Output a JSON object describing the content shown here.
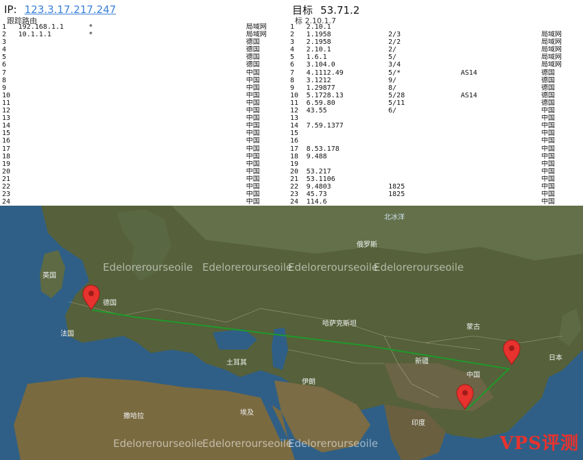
{
  "left_panel": {
    "header_label": "IP:",
    "header_ip": "123.3.17.217.247",
    "subtitle": "跟踪路由"
  },
  "right_panel": {
    "header_label": "目标",
    "header_ip": "53.71.2",
    "subtitle": "标 2.10.1.7"
  },
  "left_hops": [
    {
      "no": "1",
      "ip": "192.168.1.1",
      "loss": "*",
      "t1": "",
      "t2": "",
      "t3": "",
      "asn": "",
      "host": "",
      "loc": "局域网"
    },
    {
      "no": "2",
      "ip": "10.1.1.1",
      "loss": "*",
      "t1": "",
      "t2": "",
      "t3": "",
      "asn": "",
      "host": "",
      "loc": "局域网"
    },
    {
      "no": "3",
      "ip": "",
      "loss": "",
      "t1": "",
      "t2": "",
      "t3": "",
      "asn": "",
      "host": "",
      "loc": "德国"
    },
    {
      "no": "4",
      "ip": "",
      "loss": "",
      "t1": "",
      "t2": "",
      "t3": "",
      "asn": "",
      "host": "",
      "loc": "德国"
    },
    {
      "no": "5",
      "ip": "",
      "loss": "",
      "t1": "",
      "t2": "",
      "t3": "",
      "asn": "",
      "host": "",
      "loc": "德国"
    },
    {
      "no": "6",
      "ip": "",
      "loss": "",
      "t1": "",
      "t2": "",
      "t3": "",
      "asn": "",
      "host": "",
      "loc": "德国"
    },
    {
      "no": "7",
      "ip": "",
      "loss": "",
      "t1": "",
      "t2": "",
      "t3": "",
      "asn": "",
      "host": "",
      "loc": "中国"
    },
    {
      "no": "8",
      "ip": "",
      "loss": "",
      "t1": "",
      "t2": "",
      "t3": "",
      "asn": "",
      "host": "",
      "loc": "中国"
    },
    {
      "no": "9",
      "ip": "",
      "loss": "",
      "t1": "",
      "t2": "",
      "t3": "",
      "asn": "",
      "host": "",
      "loc": "中国"
    },
    {
      "no": "10",
      "ip": "",
      "loss": "",
      "t1": "",
      "t2": "",
      "t3": "",
      "asn": "",
      "host": "",
      "loc": "中国"
    },
    {
      "no": "11",
      "ip": "",
      "loss": "",
      "t1": "",
      "t2": "",
      "t3": "",
      "asn": "",
      "host": "",
      "loc": "中国"
    },
    {
      "no": "12",
      "ip": "",
      "loss": "",
      "t1": "",
      "t2": "",
      "t3": "",
      "asn": "",
      "host": "",
      "loc": "中国"
    },
    {
      "no": "13",
      "ip": "",
      "loss": "",
      "t1": "",
      "t2": "",
      "t3": "",
      "asn": "",
      "host": "",
      "loc": "中国"
    },
    {
      "no": "14",
      "ip": "",
      "loss": "",
      "t1": "",
      "t2": "",
      "t3": "",
      "asn": "",
      "host": "",
      "loc": "中国"
    },
    {
      "no": "15",
      "ip": "",
      "loss": "",
      "t1": "",
      "t2": "",
      "t3": "",
      "asn": "",
      "host": "",
      "loc": "中国"
    },
    {
      "no": "16",
      "ip": "",
      "loss": "",
      "t1": "",
      "t2": "",
      "t3": "",
      "asn": "",
      "host": "",
      "loc": "中国"
    },
    {
      "no": "17",
      "ip": "",
      "loss": "",
      "t1": "",
      "t2": "",
      "t3": "",
      "asn": "",
      "host": "",
      "loc": "中国"
    },
    {
      "no": "18",
      "ip": "",
      "loss": "",
      "t1": "",
      "t2": "",
      "t3": "",
      "asn": "",
      "host": "",
      "loc": "中国"
    },
    {
      "no": "19",
      "ip": "",
      "loss": "",
      "t1": "",
      "t2": "",
      "t3": "",
      "asn": "",
      "host": "",
      "loc": "中国"
    },
    {
      "no": "20",
      "ip": "",
      "loss": "",
      "t1": "",
      "t2": "",
      "t3": "",
      "asn": "",
      "host": "",
      "loc": "中国"
    },
    {
      "no": "21",
      "ip": "",
      "loss": "",
      "t1": "",
      "t2": "",
      "t3": "",
      "asn": "",
      "host": "",
      "loc": "中国"
    },
    {
      "no": "22",
      "ip": "",
      "loss": "",
      "t1": "",
      "t2": "",
      "t3": "",
      "asn": "",
      "host": "",
      "loc": "中国"
    },
    {
      "no": "23",
      "ip": "",
      "loss": "",
      "t1": "",
      "t2": "",
      "t3": "",
      "asn": "",
      "host": "",
      "loc": "中国"
    },
    {
      "no": "24",
      "ip": "",
      "loss": "",
      "t1": "",
      "t2": "",
      "t3": "",
      "asn": "",
      "host": "",
      "loc": "中国"
    }
  ],
  "right_hops": [
    {
      "no": "1",
      "ip": "2.10.1",
      "loss": "",
      "t1": "",
      "t2": "",
      "t3": "",
      "asn": "",
      "host": "",
      "loc": ""
    },
    {
      "no": "2",
      "ip": "1.1958",
      "loss": "",
      "t1": "2/3",
      "t2": "",
      "t3": "",
      "asn": "",
      "host": "",
      "loc": "局域网"
    },
    {
      "no": "3",
      "ip": "2.1958",
      "loss": "",
      "t1": "2/2",
      "t2": "",
      "t3": "",
      "asn": "",
      "host": "",
      "loc": "局域网"
    },
    {
      "no": "4",
      "ip": "2.10.1",
      "loss": "",
      "t1": "2/",
      "t2": "",
      "t3": "",
      "asn": "",
      "host": "",
      "loc": "局域网"
    },
    {
      "no": "5",
      "ip": "1.6.1",
      "loss": "",
      "t1": "5/",
      "t2": "",
      "t3": "",
      "asn": "",
      "host": "",
      "loc": "局域网"
    },
    {
      "no": "6",
      "ip": "3.104.0",
      "loss": "",
      "t1": "3/4",
      "t2": "",
      "t3": "",
      "asn": "",
      "host": "",
      "loc": "局域网"
    },
    {
      "no": "7",
      "ip": "4.1112.49",
      "loss": "",
      "t1": "5/*",
      "t2": "",
      "t3": "",
      "asn": "AS14",
      "host": "",
      "loc": "德国"
    },
    {
      "no": "8",
      "ip": "3.1212",
      "loss": "",
      "t1": "9/",
      "t2": "",
      "t3": "",
      "asn": "",
      "host": "",
      "loc": "德国"
    },
    {
      "no": "9",
      "ip": "1.29877",
      "loss": "",
      "t1": "8/",
      "t2": "",
      "t3": "",
      "asn": "",
      "host": "",
      "loc": "德国"
    },
    {
      "no": "10",
      "ip": "5.1728.13",
      "loss": "",
      "t1": "5/28",
      "t2": "",
      "t3": "",
      "asn": "AS14",
      "host": "",
      "loc": "德国"
    },
    {
      "no": "11",
      "ip": "6.59.80",
      "loss": "",
      "t1": "5/11",
      "t2": "",
      "t3": "",
      "asn": "",
      "host": "",
      "loc": "德国"
    },
    {
      "no": "12",
      "ip": "43.55",
      "loss": "",
      "t1": "6/",
      "t2": "",
      "t3": "",
      "asn": "",
      "host": "",
      "loc": "中国"
    },
    {
      "no": "13",
      "ip": "",
      "loss": "",
      "t1": "",
      "t2": "",
      "t3": "",
      "asn": "",
      "host": "",
      "loc": "中国"
    },
    {
      "no": "14",
      "ip": "7.59.1377",
      "loss": "",
      "t1": "",
      "t2": "",
      "t3": "",
      "asn": "",
      "host": "",
      "loc": "中国"
    },
    {
      "no": "15",
      "ip": "",
      "loss": "",
      "t1": "",
      "t2": "",
      "t3": "",
      "asn": "",
      "host": "",
      "loc": "中国"
    },
    {
      "no": "16",
      "ip": "",
      "loss": "",
      "t1": "",
      "t2": "",
      "t3": "",
      "asn": "",
      "host": "",
      "loc": "中国"
    },
    {
      "no": "17",
      "ip": "8.53.178",
      "loss": "",
      "t1": "",
      "t2": "",
      "t3": "",
      "asn": "",
      "host": "",
      "loc": "中国"
    },
    {
      "no": "18",
      "ip": "9.488",
      "loss": "",
      "t1": "",
      "t2": "",
      "t3": "",
      "asn": "",
      "host": "",
      "loc": "中国"
    },
    {
      "no": "19",
      "ip": "",
      "loss": "",
      "t1": "",
      "t2": "",
      "t3": "",
      "asn": "",
      "host": "",
      "loc": "中国"
    },
    {
      "no": "20",
      "ip": "53.217",
      "loss": "",
      "t1": "",
      "t2": "",
      "t3": "",
      "asn": "",
      "host": "",
      "loc": "中国"
    },
    {
      "no": "21",
      "ip": "53.1106",
      "loss": "",
      "t1": "",
      "t2": "",
      "t3": "",
      "asn": "",
      "host": "",
      "loc": "中国"
    },
    {
      "no": "22",
      "ip": "9.4803",
      "loss": "",
      "t1": "1825",
      "t2": "",
      "t3": "",
      "asn": "",
      "host": "",
      "loc": "中国"
    },
    {
      "no": "23",
      "ip": "45.73",
      "loss": "",
      "t1": "1825",
      "t2": "",
      "t3": "",
      "asn": "",
      "host": "",
      "loc": "中国"
    },
    {
      "no": "24",
      "ip": "114.6",
      "loss": "",
      "t1": "",
      "t2": "",
      "t3": "",
      "asn": "",
      "host": "",
      "loc": "中国"
    }
  ],
  "map": {
    "watermark": "Edelorerourseoile",
    "brand": "VPS评测",
    "labels": {
      "uk": "英国",
      "france": "法国",
      "germany": "德国",
      "russia": "俄罗斯",
      "kazakhstan": "哈萨克斯坦",
      "china": "中国",
      "mongolia": "蒙古",
      "turkey": "土耳其",
      "iran": "伊朗",
      "xinjiang": "新疆",
      "india": "印度",
      "egypt": "埃及",
      "sahara": "撒哈拉",
      "japan": "日本",
      "arctic": "北冰洋"
    }
  }
}
